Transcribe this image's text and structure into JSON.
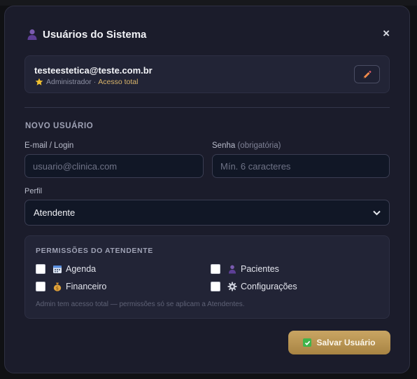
{
  "modal": {
    "title": "Usuários do Sistema",
    "close_label": "×"
  },
  "current_user": {
    "email": "testeestetica@teste.com.br",
    "role": "Administrador",
    "separator": "·",
    "access": "Acesso total"
  },
  "form": {
    "section_title": "NOVO USUÁRIO",
    "email_label": "E-mail / Login",
    "email_value": "",
    "email_placeholder": "usuario@clinica.com",
    "password_label": "Senha",
    "password_hint": "(obrigatória)",
    "password_value": "",
    "password_placeholder": "Mín. 6 caracteres",
    "profile_label": "Perfil",
    "profile_value": "Atendente"
  },
  "permissions": {
    "title": "PERMISSÕES DO ATENDENTE",
    "items": [
      {
        "label": "Agenda",
        "icon": "calendar-icon",
        "checked": false
      },
      {
        "label": "Pacientes",
        "icon": "user-icon",
        "checked": false
      },
      {
        "label": "Financeiro",
        "icon": "money-bag-icon",
        "checked": false
      },
      {
        "label": "Configurações",
        "icon": "gear-icon",
        "checked": false
      }
    ],
    "note": "Admin tem acesso total — permissões só se aplicam a Atendentes."
  },
  "actions": {
    "save_label": "Salvar Usuário"
  },
  "colors": {
    "modal_bg": "#1b1c2b",
    "accent_gold": "#c9a563",
    "access_text": "#d9b46a"
  }
}
